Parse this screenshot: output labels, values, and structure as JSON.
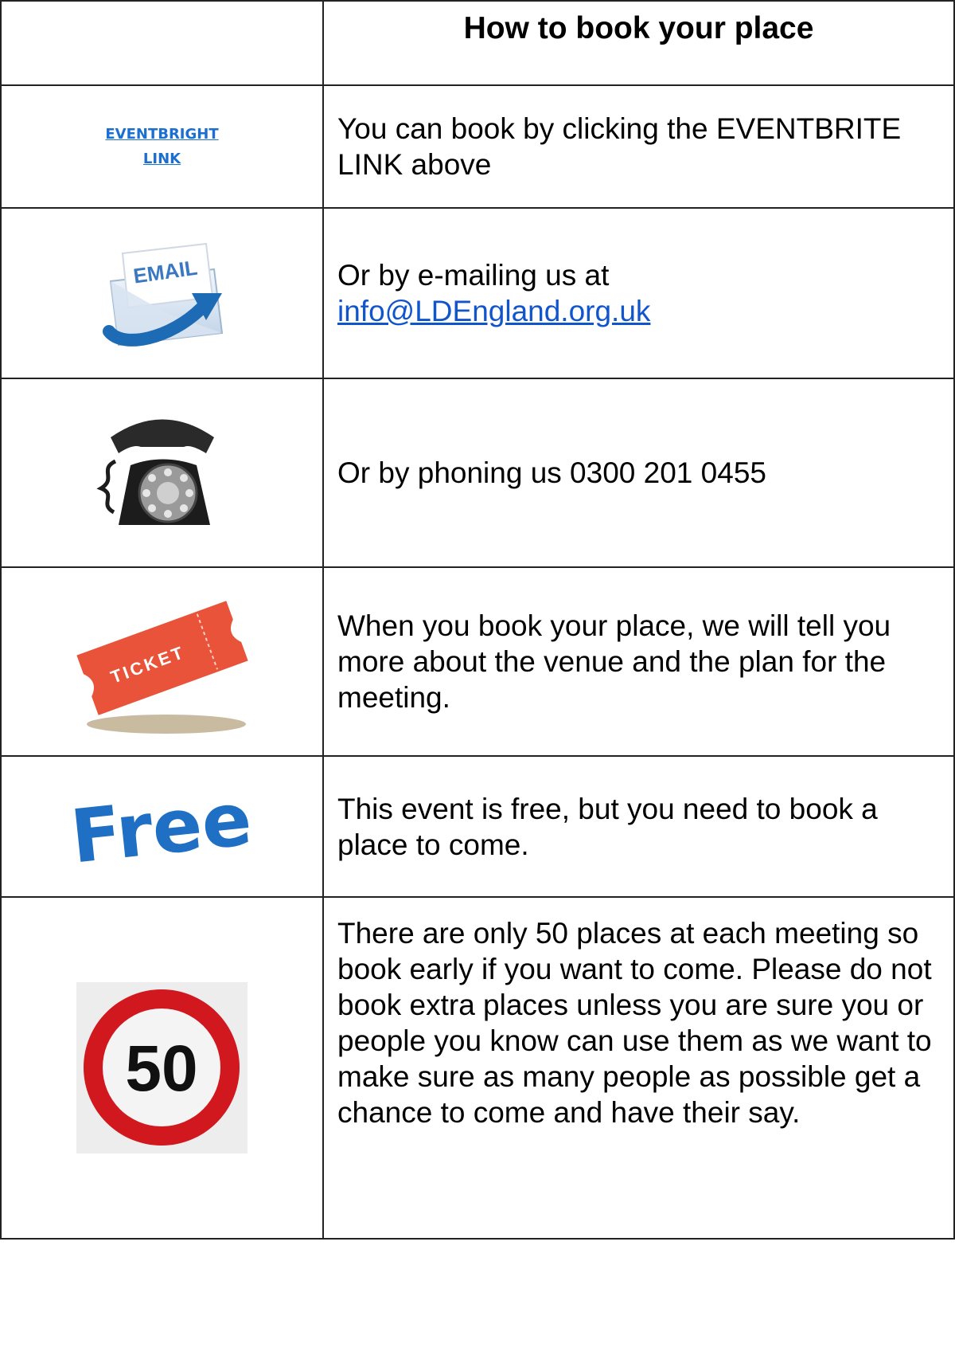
{
  "header": {
    "title": "How to book your place"
  },
  "rows": {
    "eventbrite": {
      "link_label": "EVENTBRIGHT LINK",
      "text": "You can book by clicking the EVENTBRITE LINK above"
    },
    "email": {
      "icon_label": "EMAIL",
      "text_prefix": "Or by e-mailing us at",
      "email": "info@LDEngland.org.uk"
    },
    "phone": {
      "text": "Or by phoning us 0300 201 0455"
    },
    "ticket": {
      "icon_label": "TICKET",
      "text": "When you book your place, we will tell you more about the venue and the plan for the meeting."
    },
    "free": {
      "icon_label": "Free",
      "text": "This event is free, but you need to book a place to come."
    },
    "limit": {
      "icon_label": "50",
      "text": "There are only 50 places at each meeting so book early if you want to come. Please do not book extra places unless you are sure you or people you know can use them as we want to make sure as many people as possible get a chance to come and have their say."
    }
  },
  "colors": {
    "link": "#1a6fd0",
    "email_link": "#1155cc",
    "ticket": "#e8533a",
    "free_blue": "#1f6fc4",
    "sign_red": "#d0181e"
  }
}
